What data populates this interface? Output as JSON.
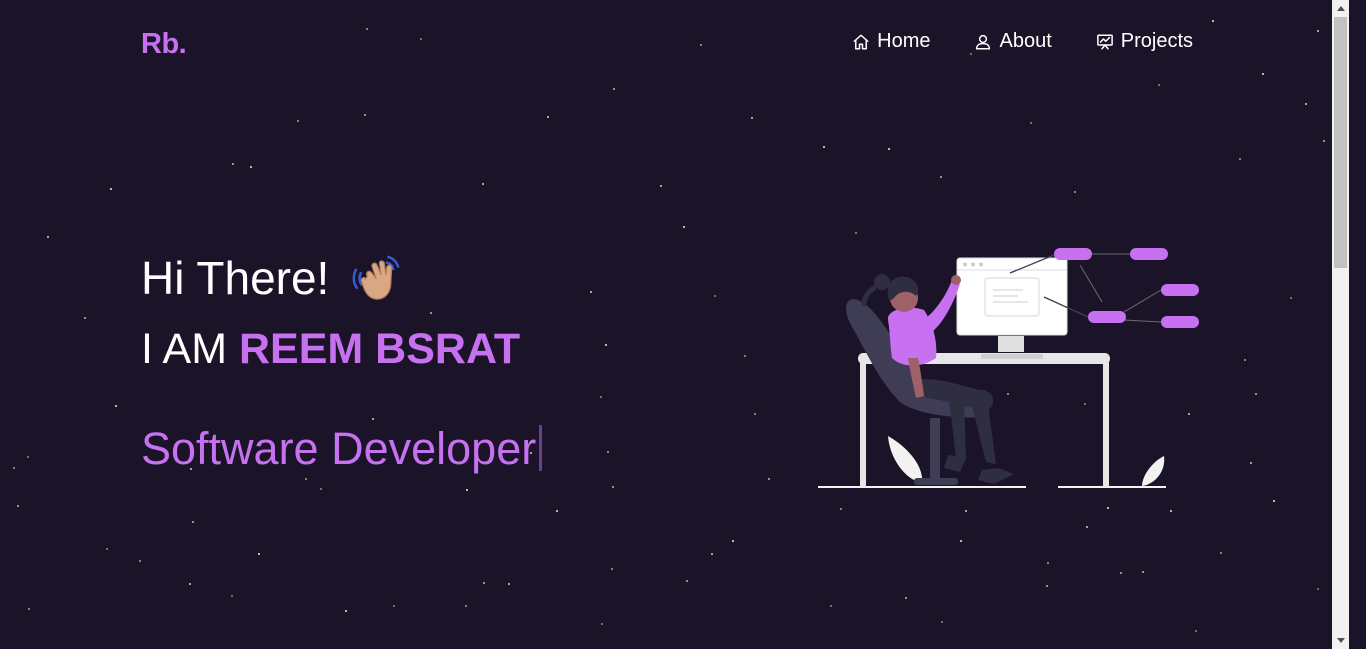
{
  "logo": {
    "text": "Rb."
  },
  "nav": {
    "items": [
      {
        "label": "Home",
        "icon": "home-icon"
      },
      {
        "label": "About",
        "icon": "user-icon"
      },
      {
        "label": "Projects",
        "icon": "projects-icon"
      }
    ]
  },
  "hero": {
    "greeting": "Hi There!",
    "greeting_emoji": "waving-hand-icon",
    "intro_prefix": "I AM",
    "name": "REEM BSRAT",
    "role": "Software Developer"
  },
  "colors": {
    "background": "#1b1429",
    "accent": "#c770f0",
    "text": "#ffffff"
  }
}
